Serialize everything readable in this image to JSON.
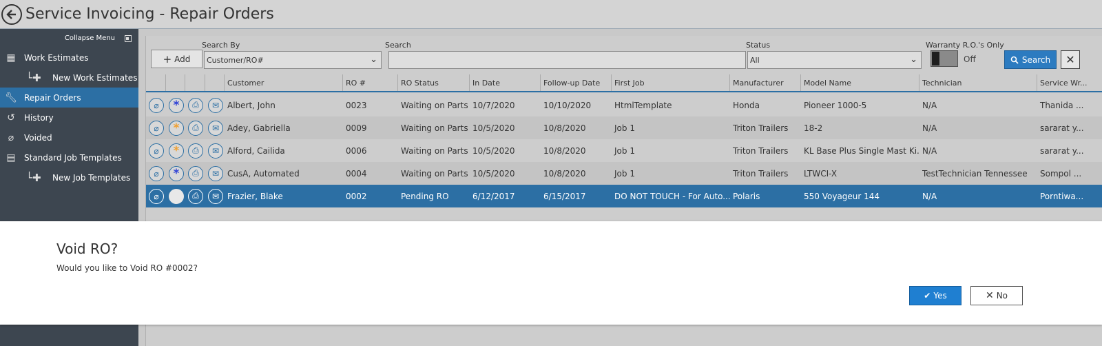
{
  "window": {
    "title": "Service Invoicing - Repair Orders"
  },
  "sidebar": {
    "collapse_label": "Collapse Menu",
    "items": [
      {
        "label": "Work Estimates",
        "icon": "calculator-icon"
      },
      {
        "label": "New Work Estimates",
        "icon": "plus-icon"
      },
      {
        "label": "Repair Orders",
        "icon": "wrench-icon"
      },
      {
        "label": "History",
        "icon": "history-icon"
      },
      {
        "label": "Voided",
        "icon": "void-icon"
      },
      {
        "label": "Standard Job Templates",
        "icon": "document-icon"
      },
      {
        "label": "New Job Templates",
        "icon": "plus-icon"
      }
    ]
  },
  "toolbar": {
    "add_label": "Add",
    "search_by_label": "Search By",
    "search_by_value": "Customer/RO#",
    "search_label": "Search",
    "search_value": "",
    "status_label": "Status",
    "status_value": "All",
    "warranty_label": "Warranty R.O.'s Only",
    "warranty_state": "Off",
    "search_button": "Search"
  },
  "table": {
    "columns": [
      "Customer",
      "RO #",
      "RO Status",
      "In Date",
      "Follow-up Date",
      "First Job",
      "Manufacturer",
      "Model Name",
      "Technician",
      "Service Wr..."
    ],
    "rows": [
      {
        "customer": "Albert, John",
        "ro": "0023",
        "status": "Waiting on Parts",
        "in_date": "10/7/2020",
        "followup": "10/10/2020",
        "first_job": "HtmlTemplate",
        "manufacturer": "Honda",
        "model": "Pioneer 1000-5",
        "technician": "N/A",
        "service_writer": "Thanida ...",
        "flag": "asterisk-blue"
      },
      {
        "customer": "Adey, Gabriella",
        "ro": "0009",
        "status": "Waiting on Parts",
        "in_date": "10/5/2020",
        "followup": "10/8/2020",
        "first_job": "Job 1",
        "manufacturer": "Triton Trailers",
        "model": "18-2",
        "technician": "N/A",
        "service_writer": "sararat y...",
        "flag": "asterisk-orange"
      },
      {
        "customer": "Alford, Cailida",
        "ro": "0006",
        "status": "Waiting on Parts",
        "in_date": "10/5/2020",
        "followup": "10/8/2020",
        "first_job": "Job 1",
        "manufacturer": "Triton Trailers",
        "model": "KL Base Plus Single Mast Ki...",
        "technician": "N/A",
        "service_writer": "sararat y...",
        "flag": "asterisk-orange"
      },
      {
        "customer": "CusA, Automated",
        "ro": "0004",
        "status": "Waiting on Parts",
        "in_date": "10/5/2020",
        "followup": "10/8/2020",
        "first_job": "Job 1",
        "manufacturer": "Triton Trailers",
        "model": "LTWCI-X",
        "technician": "TestTechnician Tennessee",
        "service_writer": "Sompol ...",
        "flag": "asterisk-blue"
      },
      {
        "customer": "Frazier, Blake",
        "ro": "0002",
        "status": "Pending RO",
        "in_date": "6/12/2017",
        "followup": "6/15/2017",
        "first_job": "DO NOT TOUCH - For Auto...",
        "manufacturer": "Polaris",
        "model": "550 Voyageur 144",
        "technician": "N/A",
        "service_writer": "Porntiwa...",
        "flag": "none"
      }
    ]
  },
  "modal": {
    "title": "Void RO?",
    "message": "Would you like to Void RO #0002?",
    "yes_label": "Yes",
    "no_label": "No"
  },
  "colors": {
    "accent": "#2c6fa4",
    "sidebar_bg": "#3d4650",
    "yes_button": "#1f7fd1",
    "asterisk_blue": "#2c3fd6",
    "asterisk_orange": "#f0a030"
  }
}
